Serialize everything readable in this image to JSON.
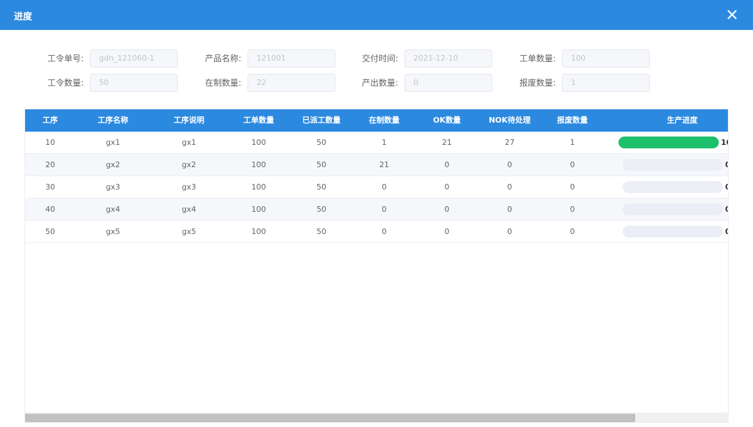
{
  "dialog": {
    "title": "进度"
  },
  "form": {
    "fields": [
      {
        "label": "工令单号:",
        "value": "gdh_121060-1"
      },
      {
        "label": "产品名称:",
        "value": "121001"
      },
      {
        "label": "交付时间:",
        "value": "2021-12-10"
      },
      {
        "label": "工单数量:",
        "value": "100"
      },
      {
        "label": "工令数量:",
        "value": "50"
      },
      {
        "label": "在制数量:",
        "value": "22"
      },
      {
        "label": "产出数量:",
        "value": "0"
      },
      {
        "label": "报废数量:",
        "value": "1"
      }
    ]
  },
  "table": {
    "columns": [
      "工序",
      "工序名称",
      "工序说明",
      "工单数量",
      "已派工数量",
      "在制数量",
      "OK数量",
      "NOK待处理",
      "报废数量",
      "生产进度"
    ],
    "rows": [
      {
        "cells": [
          "10",
          "gx1",
          "gx1",
          "100",
          "50",
          "1",
          "21",
          "27",
          "1"
        ],
        "progress": 100,
        "progress_text": "10"
      },
      {
        "cells": [
          "20",
          "gx2",
          "gx2",
          "100",
          "50",
          "21",
          "0",
          "0",
          "0"
        ],
        "progress": 0,
        "progress_text": "0"
      },
      {
        "cells": [
          "30",
          "gx3",
          "gx3",
          "100",
          "50",
          "0",
          "0",
          "0",
          "0"
        ],
        "progress": 0,
        "progress_text": "0"
      },
      {
        "cells": [
          "40",
          "gx4",
          "gx4",
          "100",
          "50",
          "0",
          "0",
          "0",
          "0"
        ],
        "progress": 0,
        "progress_text": "0"
      },
      {
        "cells": [
          "50",
          "gx5",
          "gx5",
          "100",
          "50",
          "0",
          "0",
          "0",
          "0"
        ],
        "progress": 0,
        "progress_text": "0"
      }
    ]
  },
  "colors": {
    "header": "#2b89e0",
    "progress": "#1dbf6a"
  },
  "icons": {
    "close": "close-icon"
  }
}
